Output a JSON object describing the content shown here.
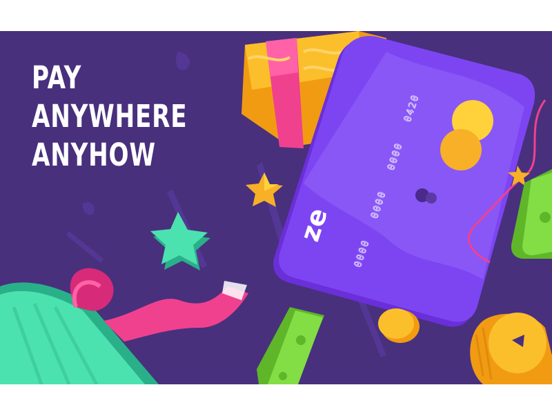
{
  "headline": {
    "lines": [
      "PAY",
      "ANYWHERE",
      "ANYHOW"
    ]
  },
  "card": {
    "brand": "ze",
    "number_groups": [
      "0000",
      "0000",
      "0000",
      "0420"
    ]
  },
  "colors": {
    "background": "#48307d",
    "card": "#7a3ff0",
    "gold": "#f7b027",
    "pink": "#f0418f",
    "teal": "#3fd6a3",
    "green": "#6ec830"
  },
  "icons": [
    "credit-card",
    "gift-box",
    "star",
    "coin",
    "banknote",
    "ribbon"
  ]
}
